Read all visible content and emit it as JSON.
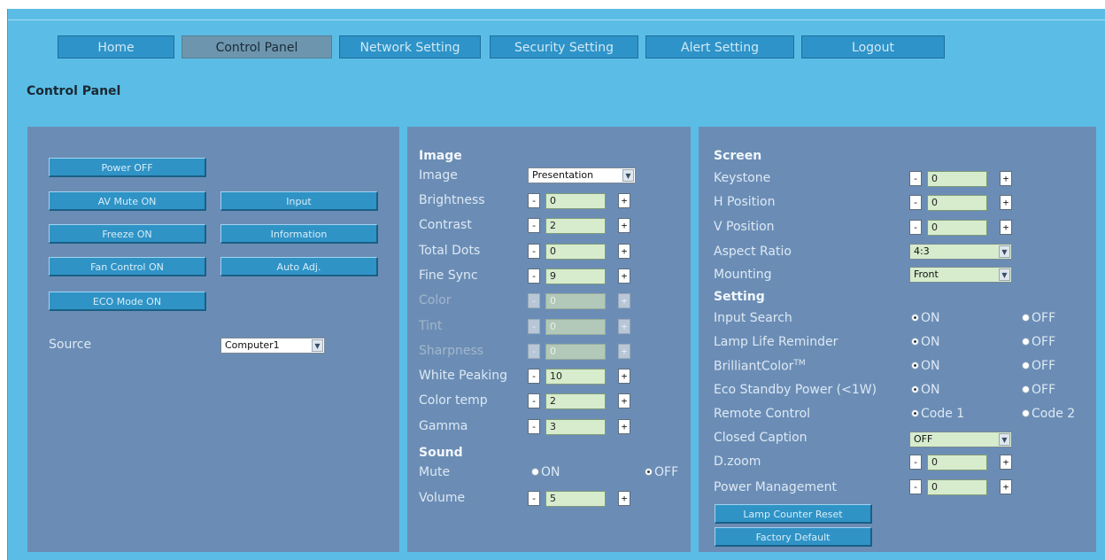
{
  "nav": {
    "tabs": [
      {
        "label": "Home"
      },
      {
        "label": "Control Panel"
      },
      {
        "label": "Network Setting"
      },
      {
        "label": "Security Setting"
      },
      {
        "label": "Alert Setting"
      },
      {
        "label": "Logout"
      }
    ],
    "active": "Control Panel"
  },
  "page_title": "Control Panel",
  "left": {
    "buttons": {
      "power_off": "Power OFF",
      "av_mute_on": "AV Mute ON",
      "input": "Input",
      "freeze_on": "Freeze ON",
      "information": "Information",
      "fan_control_on": "Fan Control ON",
      "auto_adj": "Auto Adj.",
      "eco_mode_on": "ECO Mode ON"
    },
    "source_label": "Source",
    "source_value": "Computer1"
  },
  "middle": {
    "image_title": "Image",
    "image_label": "Image",
    "image_value": "Presentation",
    "rows": [
      {
        "label": "Brightness",
        "value": "0"
      },
      {
        "label": "Contrast",
        "value": "2"
      },
      {
        "label": "Total Dots",
        "value": "0"
      },
      {
        "label": "Fine Sync",
        "value": "9"
      },
      {
        "label": "Color",
        "value": "0"
      },
      {
        "label": "Tint",
        "value": "0"
      },
      {
        "label": "Sharpness",
        "value": "0"
      },
      {
        "label": "White Peaking",
        "value": "10"
      },
      {
        "label": "Color temp",
        "value": "2"
      },
      {
        "label": "Gamma",
        "value": "3"
      }
    ],
    "sound_title": "Sound",
    "mute_label": "Mute",
    "mute_on": "ON",
    "mute_off": "OFF",
    "volume_label": "Volume",
    "volume_value": "5"
  },
  "right": {
    "screen_title": "Screen",
    "keystone_label": "Keystone",
    "keystone_value": "0",
    "hpos_label": "H Position",
    "hpos_value": "0",
    "vpos_label": "V Position",
    "vpos_value": "0",
    "aspect_label": "Aspect Ratio",
    "aspect_value": "4:3",
    "mounting_label": "Mounting",
    "mounting_value": "Front",
    "setting_title": "Setting",
    "input_search_label": "Input Search",
    "lamp_life_label": "Lamp Life Reminder",
    "brilliant_label": "BrilliantColor",
    "brilliant_tm": "TM",
    "eco_standby_label": "Eco Standby Power (<1W)",
    "on_text": "ON",
    "off_text": "OFF",
    "remote_label": "Remote Control",
    "code1": "Code 1",
    "code2": "Code 2",
    "cc_label": "Closed Caption",
    "cc_value": "OFF",
    "dzoom_label": "D.zoom",
    "dzoom_value": "0",
    "pm_label": "Power Management",
    "pm_value": "0",
    "lamp_reset_button": "Lamp Counter Reset",
    "factory_default_button": "Factory Default"
  },
  "glyphs": {
    "minus": "-",
    "plus": "+",
    "arrow": "▼"
  }
}
